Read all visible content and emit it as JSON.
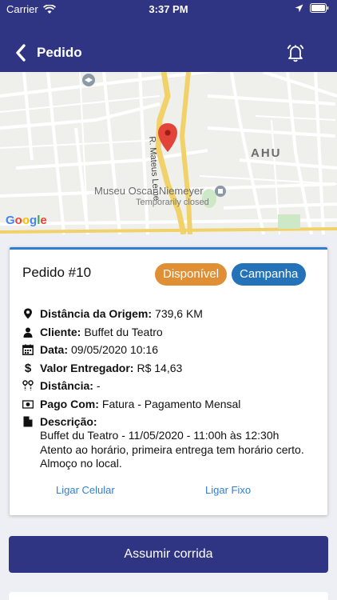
{
  "status_bar": {
    "carrier": "Carrier",
    "time": "3:37 PM"
  },
  "nav": {
    "title": "Pedido"
  },
  "map": {
    "place_name": "Museu Oscar Niemeyer",
    "place_status": "Temporarily closed",
    "district": "AHU",
    "street": "R. Mateus Leme",
    "logo": "Google"
  },
  "order": {
    "title": "Pedido #10",
    "badges": [
      {
        "label": "Disponível",
        "color": "#e08f34"
      },
      {
        "label": "Campanha",
        "color": "#2472b8"
      }
    ],
    "details": [
      {
        "icon": "map-pin-icon",
        "label": "Distância da Origem:",
        "value": "739,6 KM"
      },
      {
        "icon": "user-icon",
        "label": "Cliente:",
        "value": "Buffet du Teatro"
      },
      {
        "icon": "calendar-icon",
        "label": "Data:",
        "value": "09/05/2020 10:16"
      },
      {
        "icon": "dollar-icon",
        "label": "Valor Entregador:",
        "value": "R$ 14,63"
      },
      {
        "icon": "route-icon",
        "label": "Distância:",
        "value": "-"
      },
      {
        "icon": "cash-icon",
        "label": "Pago Com:",
        "value": "Fatura - Pagamento Mensal"
      },
      {
        "icon": "document-icon",
        "label": "Descrição:",
        "value": ""
      }
    ],
    "description": "Buffet du Teatro - 11/05/2020 - 11:00h às 12:30h Atento ao horário, primeira entrega tem horário certo. Almoço no local.",
    "links": {
      "mobile": "Ligar Celular",
      "landline": "Ligar Fixo"
    }
  },
  "action": {
    "label": "Assumir corrida"
  },
  "colors": {
    "header": "#2f3483",
    "accent": "#2f7fd1",
    "available": "#e08f34",
    "campaign": "#2472b8"
  }
}
